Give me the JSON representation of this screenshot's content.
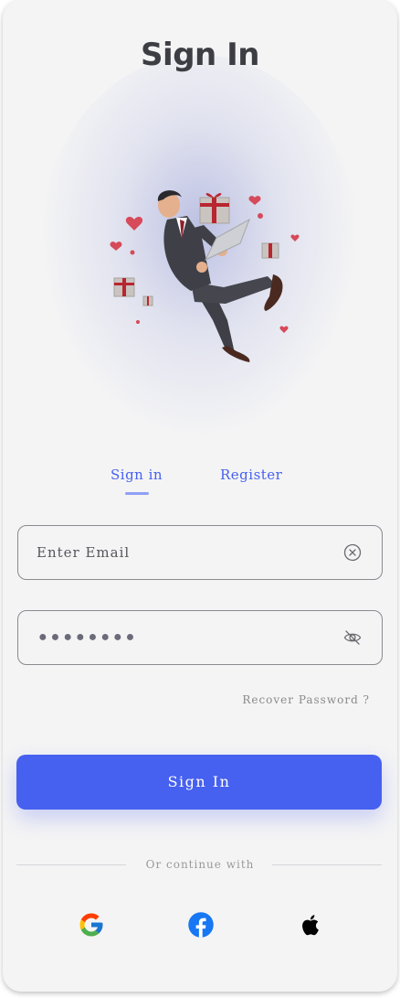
{
  "header": {
    "title": "Sign In"
  },
  "illustration": {
    "subject": "businessman-floating-with-laptop-gifts-hearts"
  },
  "tabs": [
    {
      "label": "Sign in",
      "active": true
    },
    {
      "label": "Register",
      "active": false
    }
  ],
  "form": {
    "email": {
      "placeholder": "Enter Email",
      "value": "",
      "icon": "clear-icon"
    },
    "password": {
      "masked_value": "●●●●●●●●",
      "icon": "eye-off-icon"
    },
    "recover_label": "Recover Password ?",
    "submit_label": "Sign In"
  },
  "social": {
    "divider_label": "Or continue with",
    "providers": [
      "google-icon",
      "facebook-icon",
      "apple-icon"
    ]
  },
  "colors": {
    "accent": "#4660ef",
    "background": "#f4f4f5",
    "text_dark": "#3d3d44"
  }
}
